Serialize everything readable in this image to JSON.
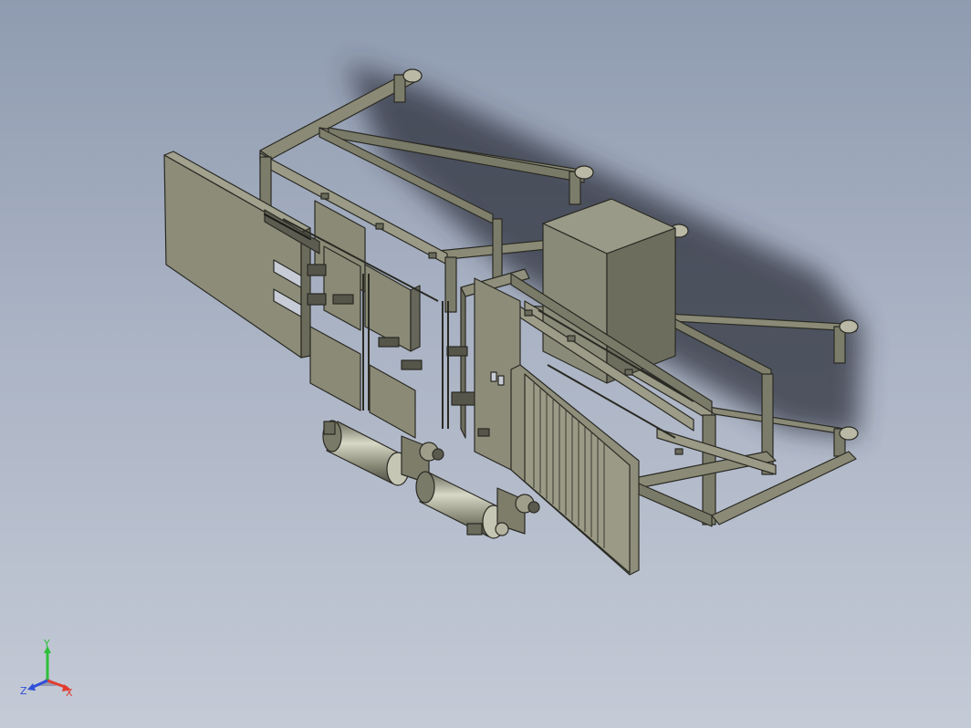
{
  "view": {
    "background_top": "#8f9bb0",
    "background_bottom": "#c4cad6",
    "model_color": "#8a8a76",
    "model_edge": "#2a2a24",
    "shadow_color": "#2f333c"
  },
  "triad": {
    "x_label": "X",
    "y_label": "Y",
    "z_label": "Z",
    "x_color": "#e23b2e",
    "y_color": "#2fbf3a",
    "z_color": "#2f4fd8"
  }
}
